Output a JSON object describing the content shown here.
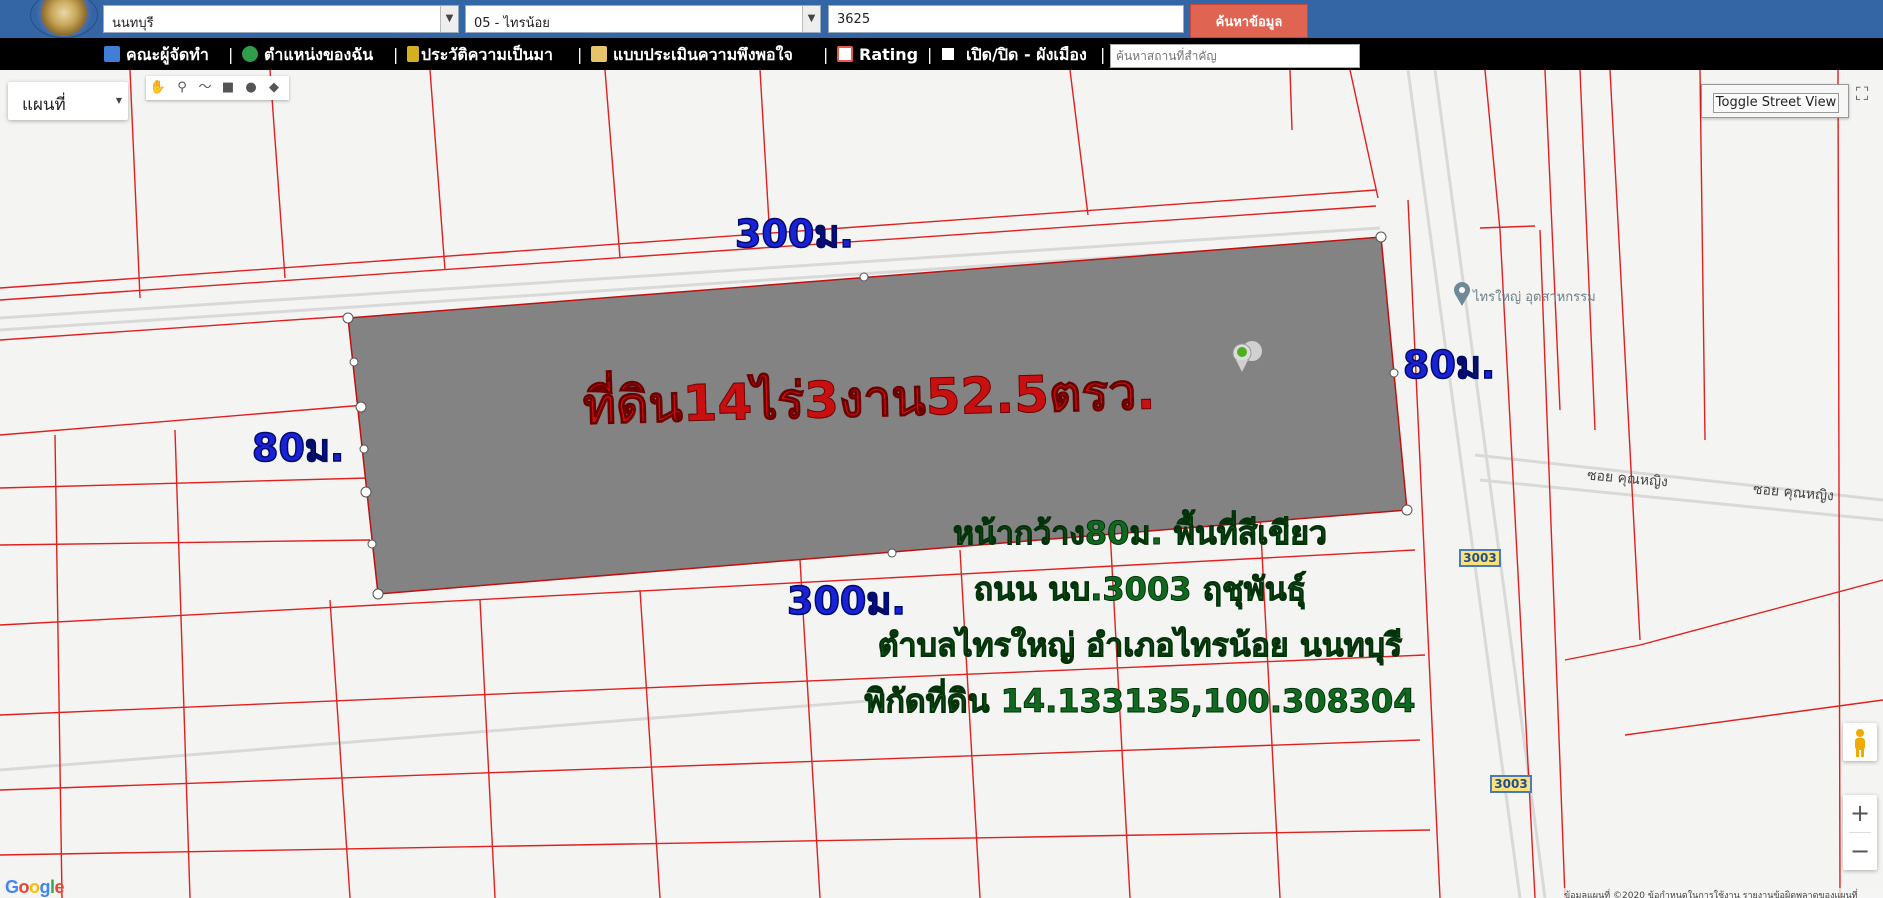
{
  "search": {
    "province": "นนทบุรี",
    "district": "05 - ไทรน้อย",
    "parcel_number": "3625",
    "submit_label": "ค้นหาข้อมูล",
    "place_placeholder": "ค้นหาสถานที่สำคัญ"
  },
  "menu": {
    "items": [
      {
        "label": "คณะผู้จัดทำ",
        "icon": "team-icon",
        "color": "#3f7fd6"
      },
      {
        "label": "ตำแหน่งของฉัน",
        "icon": "globe-icon",
        "color": "#2f9d4a"
      },
      {
        "label": "ประวัติความเป็นมา",
        "icon": "plant-icon",
        "color": "#d4b020"
      },
      {
        "label": "แบบประเมินความพึงพอใจ",
        "icon": "notepad-icon",
        "color": "#e6c46a"
      },
      {
        "label": "Rating",
        "icon": "chart-icon",
        "color": "#e65a4a"
      },
      {
        "label": "เปิด/ปิด - ผังเมือง",
        "icon": "checkbox-icon",
        "color": "#ffffff"
      }
    ],
    "separator": "|"
  },
  "map": {
    "type_label": "แผนที่",
    "streetview_label": "Toggle Street View",
    "zoom_in": "+",
    "zoom_out": "−",
    "google_logo": "Google",
    "attribution": "ข้อมูลแผนที่ ©2020   ข้อกำหนดในการใช้งาน   รายงานข้อผิดพลาดของแผนที่",
    "road_label": "ซอย คุณหญิง",
    "road_shield": "3003",
    "poi_label": "ไทรใหญ่ อุตสาหกรรม",
    "parcel_fill": "#7f7f7f",
    "boundary_color": "#e02020"
  },
  "annotations": {
    "area_title": "ที่ดิน14ไร่3งาน52.5ตรว.",
    "top_length": "300ม.",
    "bottom_length": "300ม.",
    "left_width": "80ม.",
    "right_width": "80ม.",
    "info_lines": [
      "หน้ากว้าง80ม. พื้นที่สีเขียว",
      "ถนน นบ.3003 ฤชุพันธุ์",
      "ตำบลไทรใหญ่ อำเภอไทรน้อย นนทบุรี",
      "พิกัดที่ดิน 14.133135,100.308304"
    ],
    "title_color": "#c81010",
    "dimension_color": "#1a22d8",
    "info_color": "#0f6a1f"
  }
}
